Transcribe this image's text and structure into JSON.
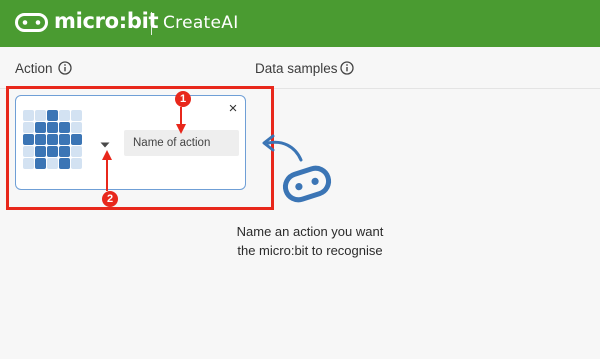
{
  "header": {
    "brand": "micro:bit",
    "app_name": "CreateAI",
    "background_color": "#4a9b31",
    "logo_icon": "microbit-logo-icon"
  },
  "columns": {
    "action_label": "Action",
    "data_samples_label": "Data samples",
    "info_icon": "info-icon"
  },
  "action_card": {
    "name_placeholder": "Name of action",
    "name_value": "",
    "close_symbol": "×",
    "dropdown_icon": "caret-down-icon",
    "led_pattern": [
      [
        0,
        0,
        1,
        0,
        0
      ],
      [
        0,
        1,
        1,
        1,
        0
      ],
      [
        1,
        1,
        1,
        1,
        1
      ],
      [
        0,
        1,
        1,
        1,
        0
      ],
      [
        0,
        1,
        0,
        1,
        0
      ]
    ],
    "led_on_color": "#3b75b5",
    "led_off_color": "#d3e2f2"
  },
  "annotations": {
    "badge_1": "1",
    "badge_2": "2",
    "color": "#e8271b"
  },
  "hint": {
    "line1": "Name an action you want",
    "line2": "the micro:bit to recognise"
  }
}
